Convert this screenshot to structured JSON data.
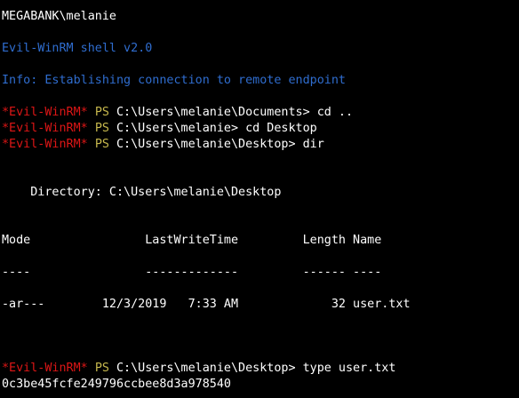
{
  "colors": {
    "background": "#000000",
    "text": "#ffffff",
    "info": "#2f6dcf",
    "prompt": "#dd1616",
    "ps": "#c7b84d"
  },
  "terminal": {
    "user_line": "MEGABANK\\melanie",
    "banner": "Evil-WinRM shell v2.0",
    "info": "Info: Establishing connection to remote endpoint",
    "prompt_tag": "*Evil-WinRM*",
    "ps_tag": "PS",
    "commands": [
      "C:\\Users\\melanie\\Documents> cd ..",
      "C:\\Users\\melanie> cd Desktop",
      "C:\\Users\\melanie\\Desktop> dir"
    ],
    "directory_line": "    Directory: C:\\Users\\melanie\\Desktop",
    "header_row": "Mode                LastWriteTime         Length Name",
    "separator_row": "----                -------------         ------ ----",
    "file_row": "-ar---        12/3/2019   7:33 AM             32 user.txt",
    "last_command": "C:\\Users\\melanie\\Desktop> type user.txt",
    "output": "0c3be45fcfe249796ccbee8d3a978540"
  }
}
